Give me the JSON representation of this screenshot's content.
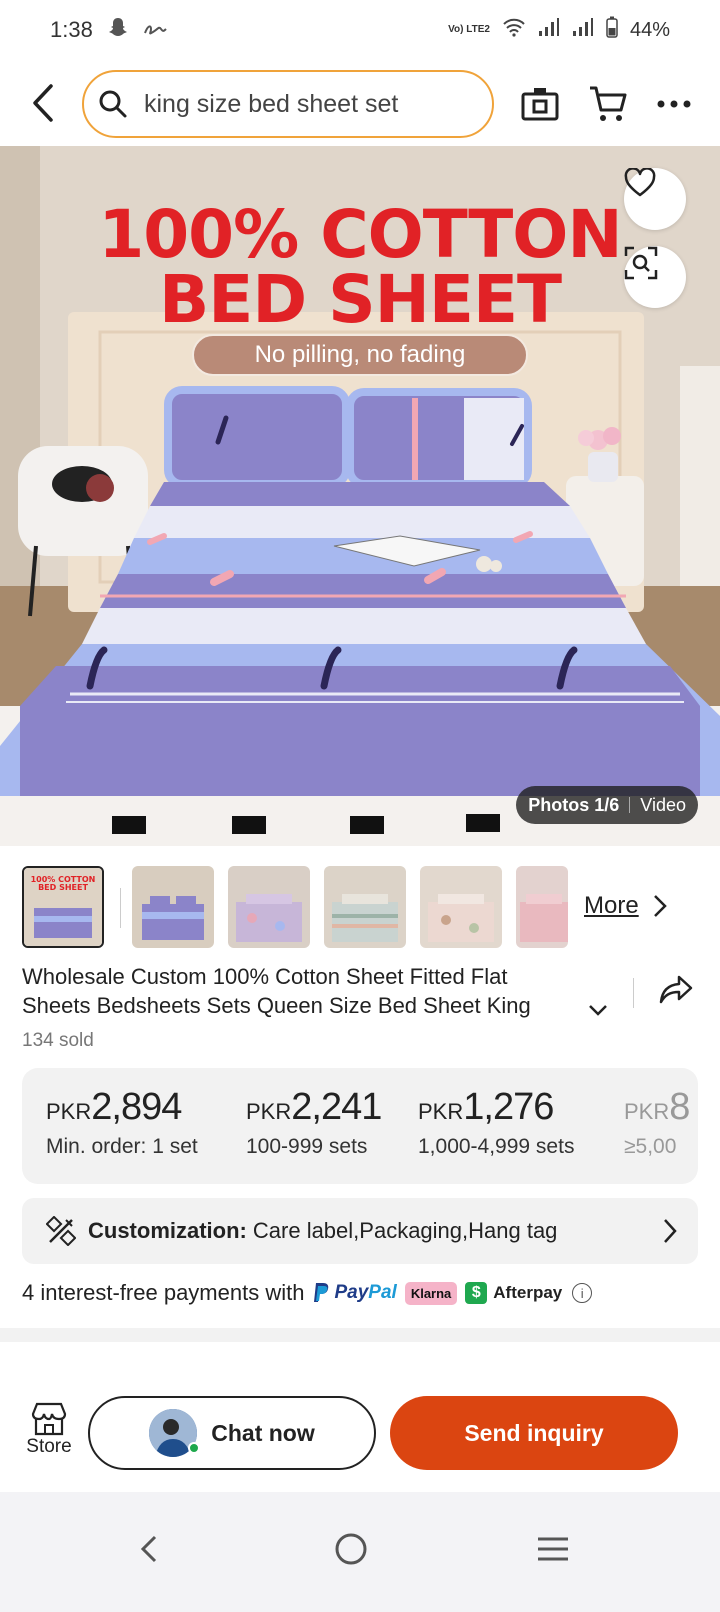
{
  "status_bar": {
    "time": "1:38",
    "volte": "Vo) LTE2",
    "battery": "44%"
  },
  "header": {
    "search_value": "king size bed sheet set",
    "icons": [
      "back-arrow-icon",
      "search-icon",
      "camera-icon",
      "cart-icon",
      "more-icon"
    ]
  },
  "hero": {
    "title_line1": "100% COTTON",
    "title_line2": "BED SHEET",
    "subtitle": "No pilling, no fading",
    "photos_label": "Photos 1/6",
    "video_label": "Video",
    "colors": {
      "title_red": "#e12226",
      "pill": "#b98a77",
      "sheet_purple": "#8b84c9",
      "sheet_blue": "#a7b8ef"
    }
  },
  "thumbnails": {
    "count_visible": 6,
    "more_label": "More"
  },
  "product": {
    "title": "Wholesale Custom 100% Cotton Sheet Fitted Flat Sheets Bedsheets Sets Queen Size Bed Sheet King",
    "sold": "134 sold"
  },
  "price_tiers": [
    {
      "currency": "PKR",
      "amount": "2,894",
      "qty": "Min. order: 1 set"
    },
    {
      "currency": "PKR",
      "amount": "2,241",
      "qty": "100-999 sets"
    },
    {
      "currency": "PKR",
      "amount": "1,276",
      "qty": "1,000-4,999 sets"
    },
    {
      "currency": "PKR",
      "amount": "8",
      "qty": "≥5,00"
    }
  ],
  "customization": {
    "label": "Customization:",
    "value": "Care label,Packaging,Hang tag"
  },
  "payments": {
    "text": "4 interest-free payments with",
    "paypal_a": "Pay",
    "paypal_b": "Pal",
    "klarna": "Klarna",
    "afterpay": "Afterpay"
  },
  "actions": {
    "store": "Store",
    "chat": "Chat now",
    "inquiry": "Send inquiry",
    "inquiry_color": "#db4511"
  }
}
